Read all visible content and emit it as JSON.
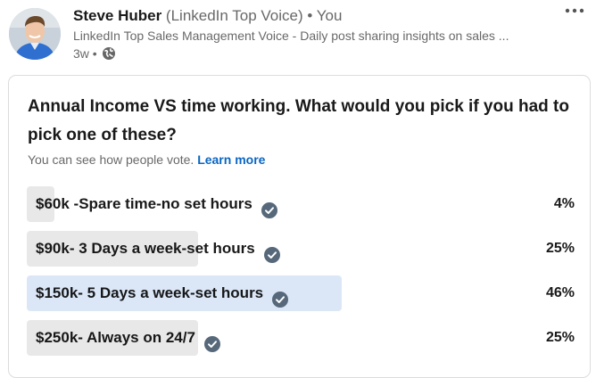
{
  "post": {
    "author_name": "Steve Huber",
    "author_meta": " (LinkedIn Top Voice) • You",
    "headline": "LinkedIn Top Sales Management Voice - Daily post sharing insights on sales ...",
    "time_ago": "3w •",
    "visibility_icon": "globe-icon",
    "more_icon": "more-icon"
  },
  "poll": {
    "question": "Annual Income VS time working. What would you pick if you had to pick one of these?",
    "vote_note": "You can see how people vote.",
    "learn_more": "Learn more",
    "options": [
      {
        "label": "$60k -Spare time-no set hours",
        "percent": "4%",
        "share": 0.04,
        "selected": false
      },
      {
        "label": "$90k- 3 Days a week-set hours",
        "percent": "25%",
        "share": 0.25,
        "selected": false
      },
      {
        "label": "$150k- 5 Days a week-set hours",
        "percent": "46%",
        "share": 0.46,
        "selected": true
      },
      {
        "label": "$250k- Always on 24/7",
        "percent": "25%",
        "share": 0.25,
        "selected": false
      }
    ]
  },
  "colors": {
    "accent": "#0a66c2",
    "bar": "#e8e8e8",
    "selected_bar": "#dbe7f7",
    "check": "#56687a"
  }
}
